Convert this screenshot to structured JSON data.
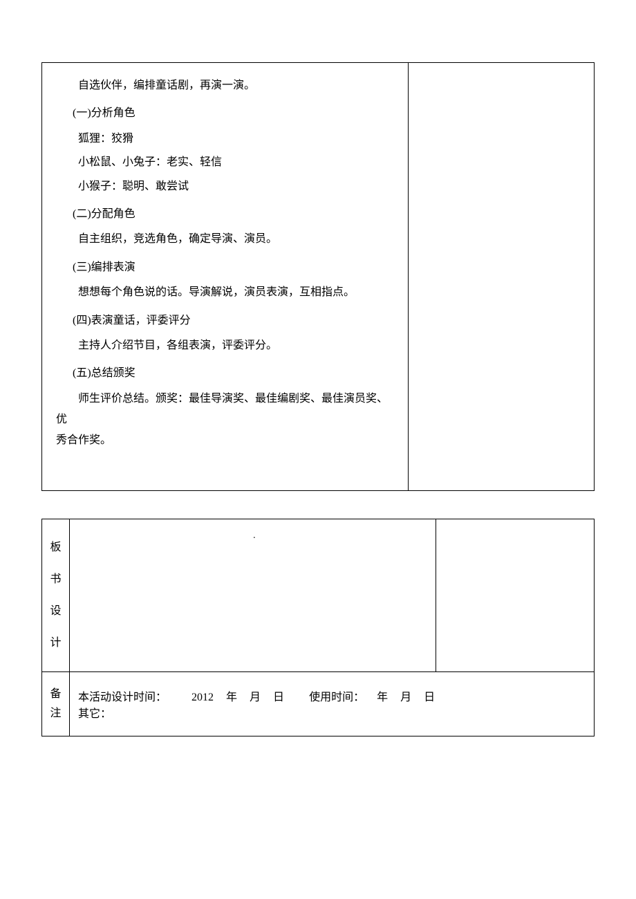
{
  "main": {
    "intro": "自选伙伴，编排童话剧，再演一演。",
    "sections": [
      {
        "heading": "(一)分析角色",
        "lines": [
          "狐狸：狡猾",
          "小松鼠、小兔子：老实、轻信",
          "小猴子：聪明、敢尝试"
        ]
      },
      {
        "heading": "(二)分配角色",
        "body": "自主组织，竞选角色，确定导演、演员。"
      },
      {
        "heading": "(三)编排表演",
        "body": "想想每个角色说的话。导演解说，演员表演，互相指点。"
      },
      {
        "heading": "(四)表演童话，评委评分",
        "body": "主持人介绍节目，各组表演，评委评分。"
      },
      {
        "heading": "(五)总结颁奖",
        "body_wrap1": "师生评价总结。颁奖：最佳导演奖、最佳编剧奖、最佳演员奖、优",
        "body_wrap2": "秀合作奖。"
      }
    ]
  },
  "table2": {
    "row1_label": [
      "板",
      "书",
      "设",
      "计"
    ],
    "dot": "·",
    "row2_label": [
      "备",
      "注"
    ],
    "remarks": {
      "prefix": "本活动设计时间：",
      "year_value": "2012",
      "year": "年",
      "month": "月",
      "day": "日",
      "use_prefix": "使用时间：",
      "other": "其它："
    }
  }
}
